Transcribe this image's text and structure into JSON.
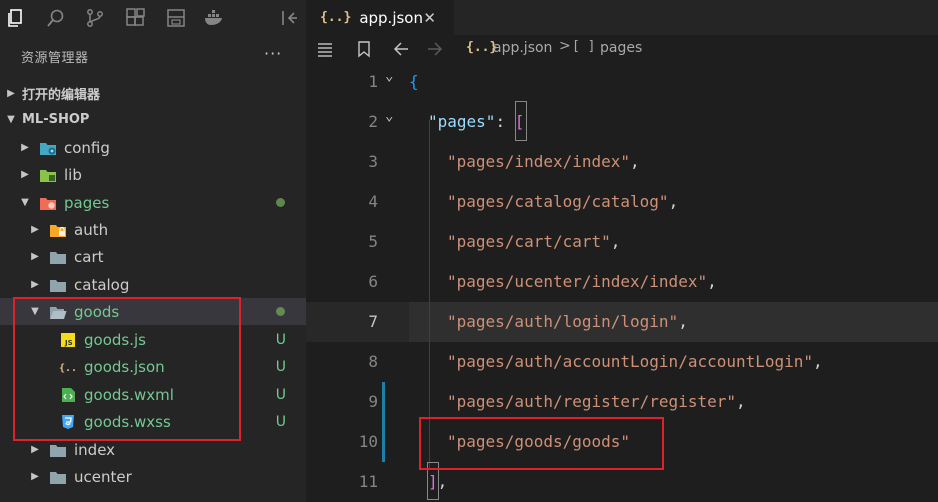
{
  "sidebar": {
    "title": "资源管理器",
    "more": "···",
    "open_editors": "打开的编辑器",
    "workspace": "ML-SHOP",
    "tree": [
      {
        "label": "config",
        "icon": "config-folder-icon",
        "state": "collapsed",
        "modified": false,
        "badge": ""
      },
      {
        "label": "lib",
        "icon": "lib-folder-icon",
        "state": "collapsed",
        "modified": false,
        "badge": ""
      },
      {
        "label": "pages",
        "icon": "pages-folder-icon",
        "state": "expanded",
        "modified": true,
        "badge": "dot"
      },
      {
        "label": "auth",
        "icon": "auth-folder-icon",
        "state": "collapsed",
        "modified": false,
        "badge": ""
      },
      {
        "label": "cart",
        "icon": "folder-icon",
        "state": "collapsed",
        "modified": false,
        "badge": ""
      },
      {
        "label": "catalog",
        "icon": "folder-icon",
        "state": "collapsed",
        "modified": false,
        "badge": ""
      },
      {
        "label": "goods",
        "icon": "folder-open-icon",
        "state": "expanded",
        "modified": true,
        "badge": "dot"
      },
      {
        "label": "goods.js",
        "icon": "js-file-icon",
        "modified": true,
        "badge": "U"
      },
      {
        "label": "goods.json",
        "icon": "json-file-icon",
        "modified": true,
        "badge": "U"
      },
      {
        "label": "goods.wxml",
        "icon": "wxml-file-icon",
        "modified": true,
        "badge": "U"
      },
      {
        "label": "goods.wxss",
        "icon": "wxss-file-icon",
        "modified": true,
        "badge": "U"
      },
      {
        "label": "index",
        "icon": "folder-icon",
        "state": "collapsed",
        "modified": false,
        "badge": ""
      },
      {
        "label": "ucenter",
        "icon": "folder-icon",
        "state": "collapsed",
        "modified": false,
        "badge": ""
      }
    ]
  },
  "editor": {
    "tab": {
      "icon_text": "{..}",
      "label": "app.json",
      "close": "✕"
    },
    "breadcrumb": {
      "icon_text": "{..}",
      "file": "app.json",
      "sep": ">",
      "symbol_icon": "[ ]",
      "symbol": "pages"
    },
    "lines": [
      {
        "n": "1",
        "text": "{"
      },
      {
        "n": "2",
        "key": "\"pages\"",
        "after": ": ",
        "open": "["
      },
      {
        "n": "3",
        "str": "\"pages/index/index\"",
        "comma": ","
      },
      {
        "n": "4",
        "str": "\"pages/catalog/catalog\"",
        "comma": ","
      },
      {
        "n": "5",
        "str": "\"pages/cart/cart\"",
        "comma": ","
      },
      {
        "n": "6",
        "str": "\"pages/ucenter/index/index\"",
        "comma": ","
      },
      {
        "n": "7",
        "str": "\"pages/auth/login/login\"",
        "comma": ","
      },
      {
        "n": "8",
        "str": "\"pages/auth/accountLogin/accountLogin\"",
        "comma": ","
      },
      {
        "n": "9",
        "str": "\"pages/auth/register/register\"",
        "comma": ","
      },
      {
        "n": "10",
        "str": "\"pages/goods/goods\"",
        "comma": ""
      },
      {
        "n": "11",
        "close": "]",
        "comma": ","
      }
    ],
    "current_line": "7"
  },
  "colors": {
    "modified_green": "#73c991",
    "annotation_red": "#e0212b",
    "json_icon_yellow": "#e2c08d"
  }
}
